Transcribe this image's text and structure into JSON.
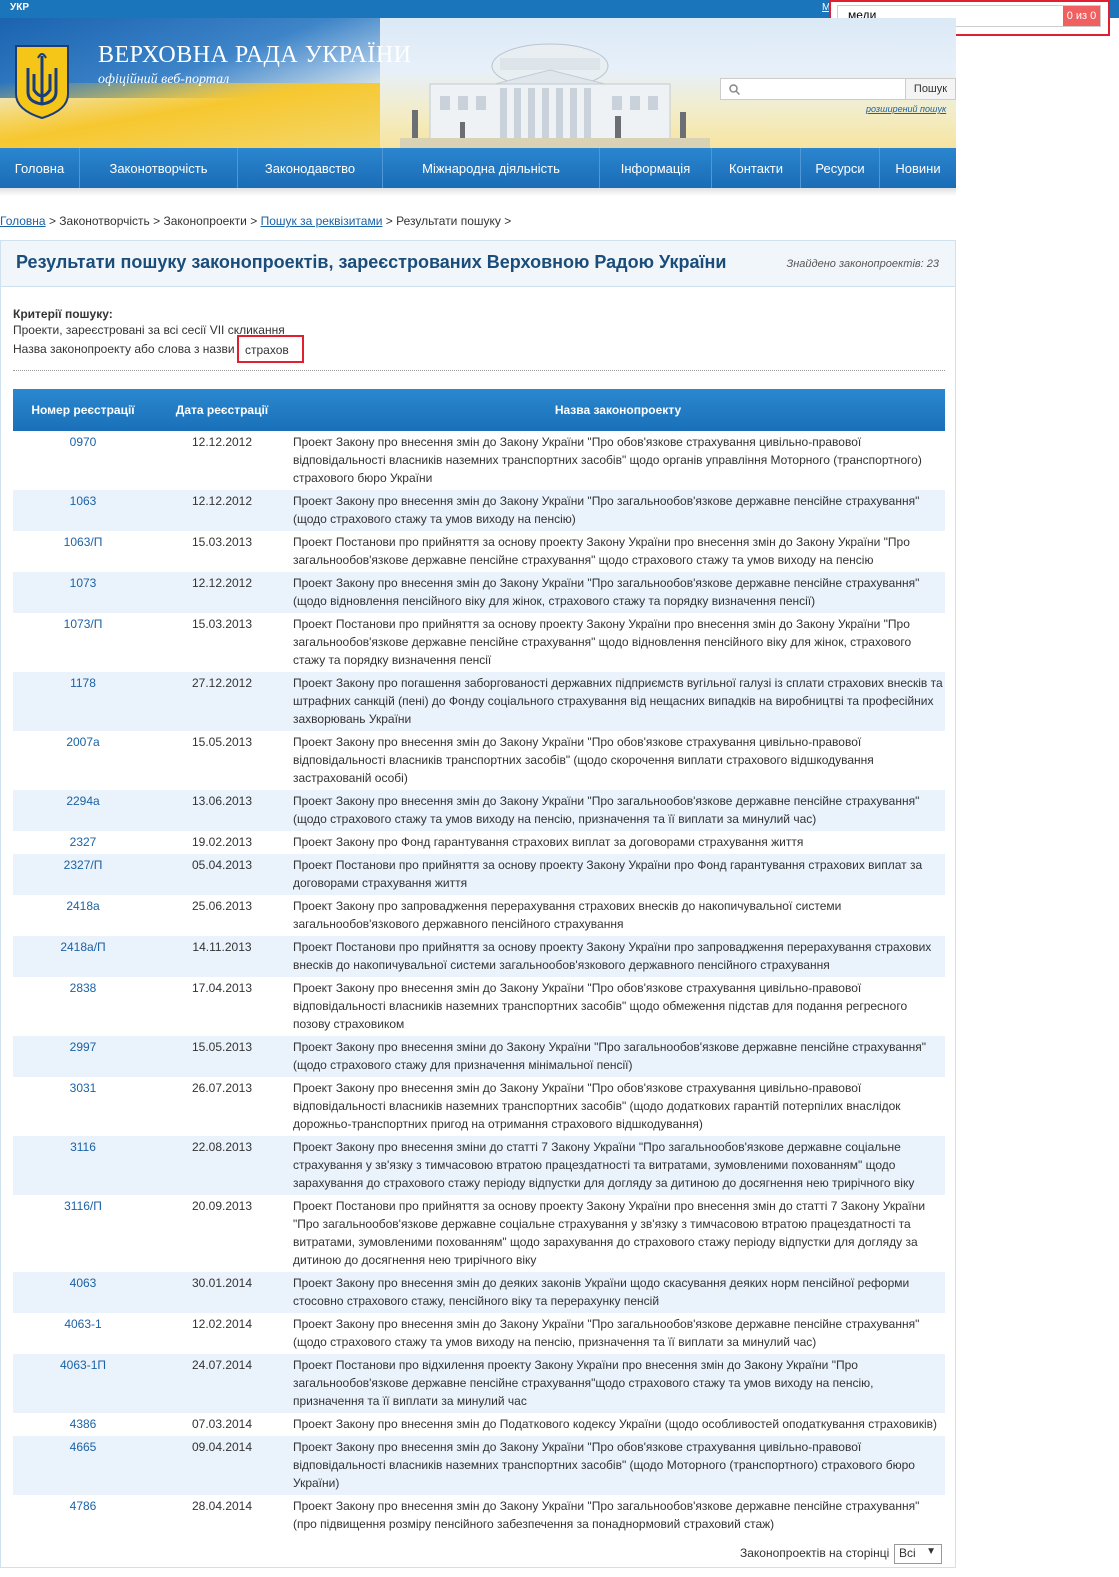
{
  "topbar": {
    "lang": "УКР",
    "m_link": "М"
  },
  "find": {
    "query": "меди",
    "count": "0 из 0"
  },
  "header": {
    "title": "ВЕРХОВНА РАДА УКРАЇНИ",
    "subtitle": "офіційний веб-портал"
  },
  "search": {
    "button": "Пошук",
    "advanced": "розширений пошук",
    "placeholder": ""
  },
  "nav": [
    {
      "label": "Головна",
      "w": 80
    },
    {
      "label": "Законотворчість",
      "w": 158
    },
    {
      "label": "Законодавство",
      "w": 145
    },
    {
      "label": "Міжнародна діяльність",
      "w": 217
    },
    {
      "label": "Інформація",
      "w": 112
    },
    {
      "label": "Контакти",
      "w": 89
    },
    {
      "label": "Ресурси",
      "w": 79
    },
    {
      "label": "Новини",
      "w": 76
    }
  ],
  "breadcrumb": {
    "home": "Головна",
    "lawmaking": "Законотворчість",
    "bills": "Законопроекти",
    "search_by_props": "Пошук за реквізитами",
    "results": "Результати пошуку"
  },
  "page": {
    "title": "Результати пошуку законопроектів, зареєстрованих Верховною Радою України",
    "found_label": "Знайдено законопроектів:",
    "found_count": "23",
    "criteria_title": "Критерії пошуку:",
    "criteria_line1": "Проекти, зареєстровані за всі сесії VII скликання",
    "criteria_line2": "Назва законопроекту або слова з назви",
    "criteria_value": "страхов"
  },
  "table": {
    "headers": {
      "number": "Номер реєстрації",
      "date": "Дата реєстрації",
      "title": "Назва законопроекту"
    },
    "rows": [
      {
        "num": "0970",
        "date": "12.12.2012",
        "title": "Проект Закону про внесення змін до Закону України \"Про обов'язкове страхування цивільно-правової відповідальності власників наземних транспортних засобів\" щодо органів управління Моторного (транспортного) страхового бюро України"
      },
      {
        "num": "1063",
        "date": "12.12.2012",
        "title": "Проект Закону про внесення змін до Закону України \"Про загальнообов'язкове державне пенсійне страхування\" (щодо страхового стажу та умов виходу на пенсію)"
      },
      {
        "num": "1063/П",
        "date": "15.03.2013",
        "title": "Проект Постанови про прийняття за основу проекту Закону України про внесення змін до Закону України \"Про загальнообов'язкове державне пенсійне страхування\" щодо страхового стажу та умов виходу на пенсію"
      },
      {
        "num": "1073",
        "date": "12.12.2012",
        "title": "Проект Закону про внесення змін до Закону України \"Про загальнообов'язкове державне пенсійне страхування\" (щодо відновлення пенсійного віку для жінок, страхового стажу та порядку визначення пенсії)"
      },
      {
        "num": "1073/П",
        "date": "15.03.2013",
        "title": "Проект Постанови про прийняття за основу проекту Закону України про внесення змін до Закону України \"Про загальнообов'язкове державне пенсійне страхування\" щодо відновлення пенсійного віку для жінок, страхового стажу та порядку визначення пенсії"
      },
      {
        "num": "1178",
        "date": "27.12.2012",
        "title": "Проект Закону про погашення заборгованості державних підприємств вугільної галузі із сплати страхових внесків та штрафних санкцій (пені) до Фонду соціального страхування від нещасних випадків на виробництві та професійних захворювань України"
      },
      {
        "num": "2007а",
        "date": "15.05.2013",
        "title": "Проект Закону про внесення змін до Закону України \"Про обов'язкове страхування цивільно-правової відповідальності власників транспортних засобів\" (щодо скорочення виплати страхового відшкодування застрахованій особі)"
      },
      {
        "num": "2294а",
        "date": "13.06.2013",
        "title": "Проект Закону про внесення змін до Закону України \"Про загальнообов'язкове державне пенсійне страхування\" (щодо страхового стажу та умов виходу на пенсію, призначення та її виплати за минулий час)"
      },
      {
        "num": "2327",
        "date": "19.02.2013",
        "title": "Проект Закону про Фонд гарантування страхових виплат за договорами страхування життя"
      },
      {
        "num": "2327/П",
        "date": "05.04.2013",
        "title": "Проект Постанови про прийняття за основу проекту Закону України про Фонд гарантування страхових виплат за договорами страхування життя"
      },
      {
        "num": "2418а",
        "date": "25.06.2013",
        "title": "Проект Закону про запровадження перерахування страхових внесків до накопичувальної системи загальнообов'язкового державного пенсійного страхування"
      },
      {
        "num": "2418а/П",
        "date": "14.11.2013",
        "title": "Проект Постанови про прийняття за основу проекту Закону України про запровадження перерахування страхових внесків до накопичувальної системи загальнообов'язкового державного пенсійного страхування"
      },
      {
        "num": "2838",
        "date": "17.04.2013",
        "title": "Проект Закону про внесення змін до Закону України \"Про обов'язкове страхування цивільно-правової відповідальності власників наземних транспортних засобів\" щодо обмеження підстав для подання регресного позову страховиком"
      },
      {
        "num": "2997",
        "date": "15.05.2013",
        "title": "Проект Закону про внесення зміни до Закону України \"Про загальнообов'язкове державне пенсійне страхування\" (щодо страхового стажу для призначення мінімальної пенсії)"
      },
      {
        "num": "3031",
        "date": "26.07.2013",
        "title": "Проект Закону про внесення змін до Закону України \"Про обов'язкове страхування цивільно-правової відповідальності власників наземних транспортних засобів\" (щодо додаткових гарантій потерпілих внаслідок дорожньо-транспортних пригод на отримання страхового відшкодування)"
      },
      {
        "num": "3116",
        "date": "22.08.2013",
        "title": "Проект Закону про внесення зміни до статті 7 Закону України \"Про загальнообов'язкове державне соціальне страхування у зв'язку з тимчасовою втратою працездатності та витратами, зумовленими похованням\" щодо зарахування до страхового стажу періоду відпустки для догляду за дитиною до досягнення нею трирічного віку"
      },
      {
        "num": "3116/П",
        "date": "20.09.2013",
        "title": "Проект Постанови про прийняття за основу проекту Закону України про внесення змін до статті 7 Закону України \"Про загальнообов'язкове державне соціальне страхування у зв'язку з тимчасовою втратою працездатності та витратами, зумовленими похованням\" щодо зарахування до страхового стажу періоду відпустки для догляду за дитиною до досягнення нею трирічного віку"
      },
      {
        "num": "4063",
        "date": "30.01.2014",
        "title": "Проект Закону про внесення змін до деяких законів України щодо скасування деяких норм пенсійної реформи стосовно страхового стажу, пенсійного віку та перерахунку пенсій"
      },
      {
        "num": "4063-1",
        "date": "12.02.2014",
        "title": "Проект Закону про внесення змін до Закону України \"Про загальнообов'язкове державне пенсійне страхування\" (щодо страхового стажу та умов виходу на пенсію, призначення та її виплати за минулий час)"
      },
      {
        "num": "4063-1П",
        "date": "24.07.2014",
        "title": "Проект Постанови про відхилення проекту Закону України про внесення змін до Закону України \"Про загальнообов'язкове державне пенсійне страхування\"щодо страхового стажу та умов виходу на пенсію, призначення та її виплати за минулий час"
      },
      {
        "num": "4386",
        "date": "07.03.2014",
        "title": "Проект Закону про внесення змін до Податкового кодексу України (щодо особливостей оподаткування страховиків)"
      },
      {
        "num": "4665",
        "date": "09.04.2014",
        "title": "Проект Закону про внесення змін до Закону України \"Про обов'язкове страхування цивільно-правової відповідальності власників наземних транспортних засобів\" (щодо Моторного (транспортного) страхового бюро України)"
      },
      {
        "num": "4786",
        "date": "28.04.2014",
        "title": "Проект Закону про внесення змін до Закону України \"Про загальнообов'язкове державне пенсійне страхування\" (про підвищення розміру пенсійного забезпечення за понаднормовий страховий стаж)"
      }
    ]
  },
  "pager": {
    "label": "Законопроектів на сторінці",
    "selected": "Всі"
  },
  "colors": {
    "accent": "#1a75bb",
    "nav": "#1a6cb6",
    "link": "#1a62a6",
    "highlight": "#e02030",
    "row_alt": "#eaf2fb"
  }
}
